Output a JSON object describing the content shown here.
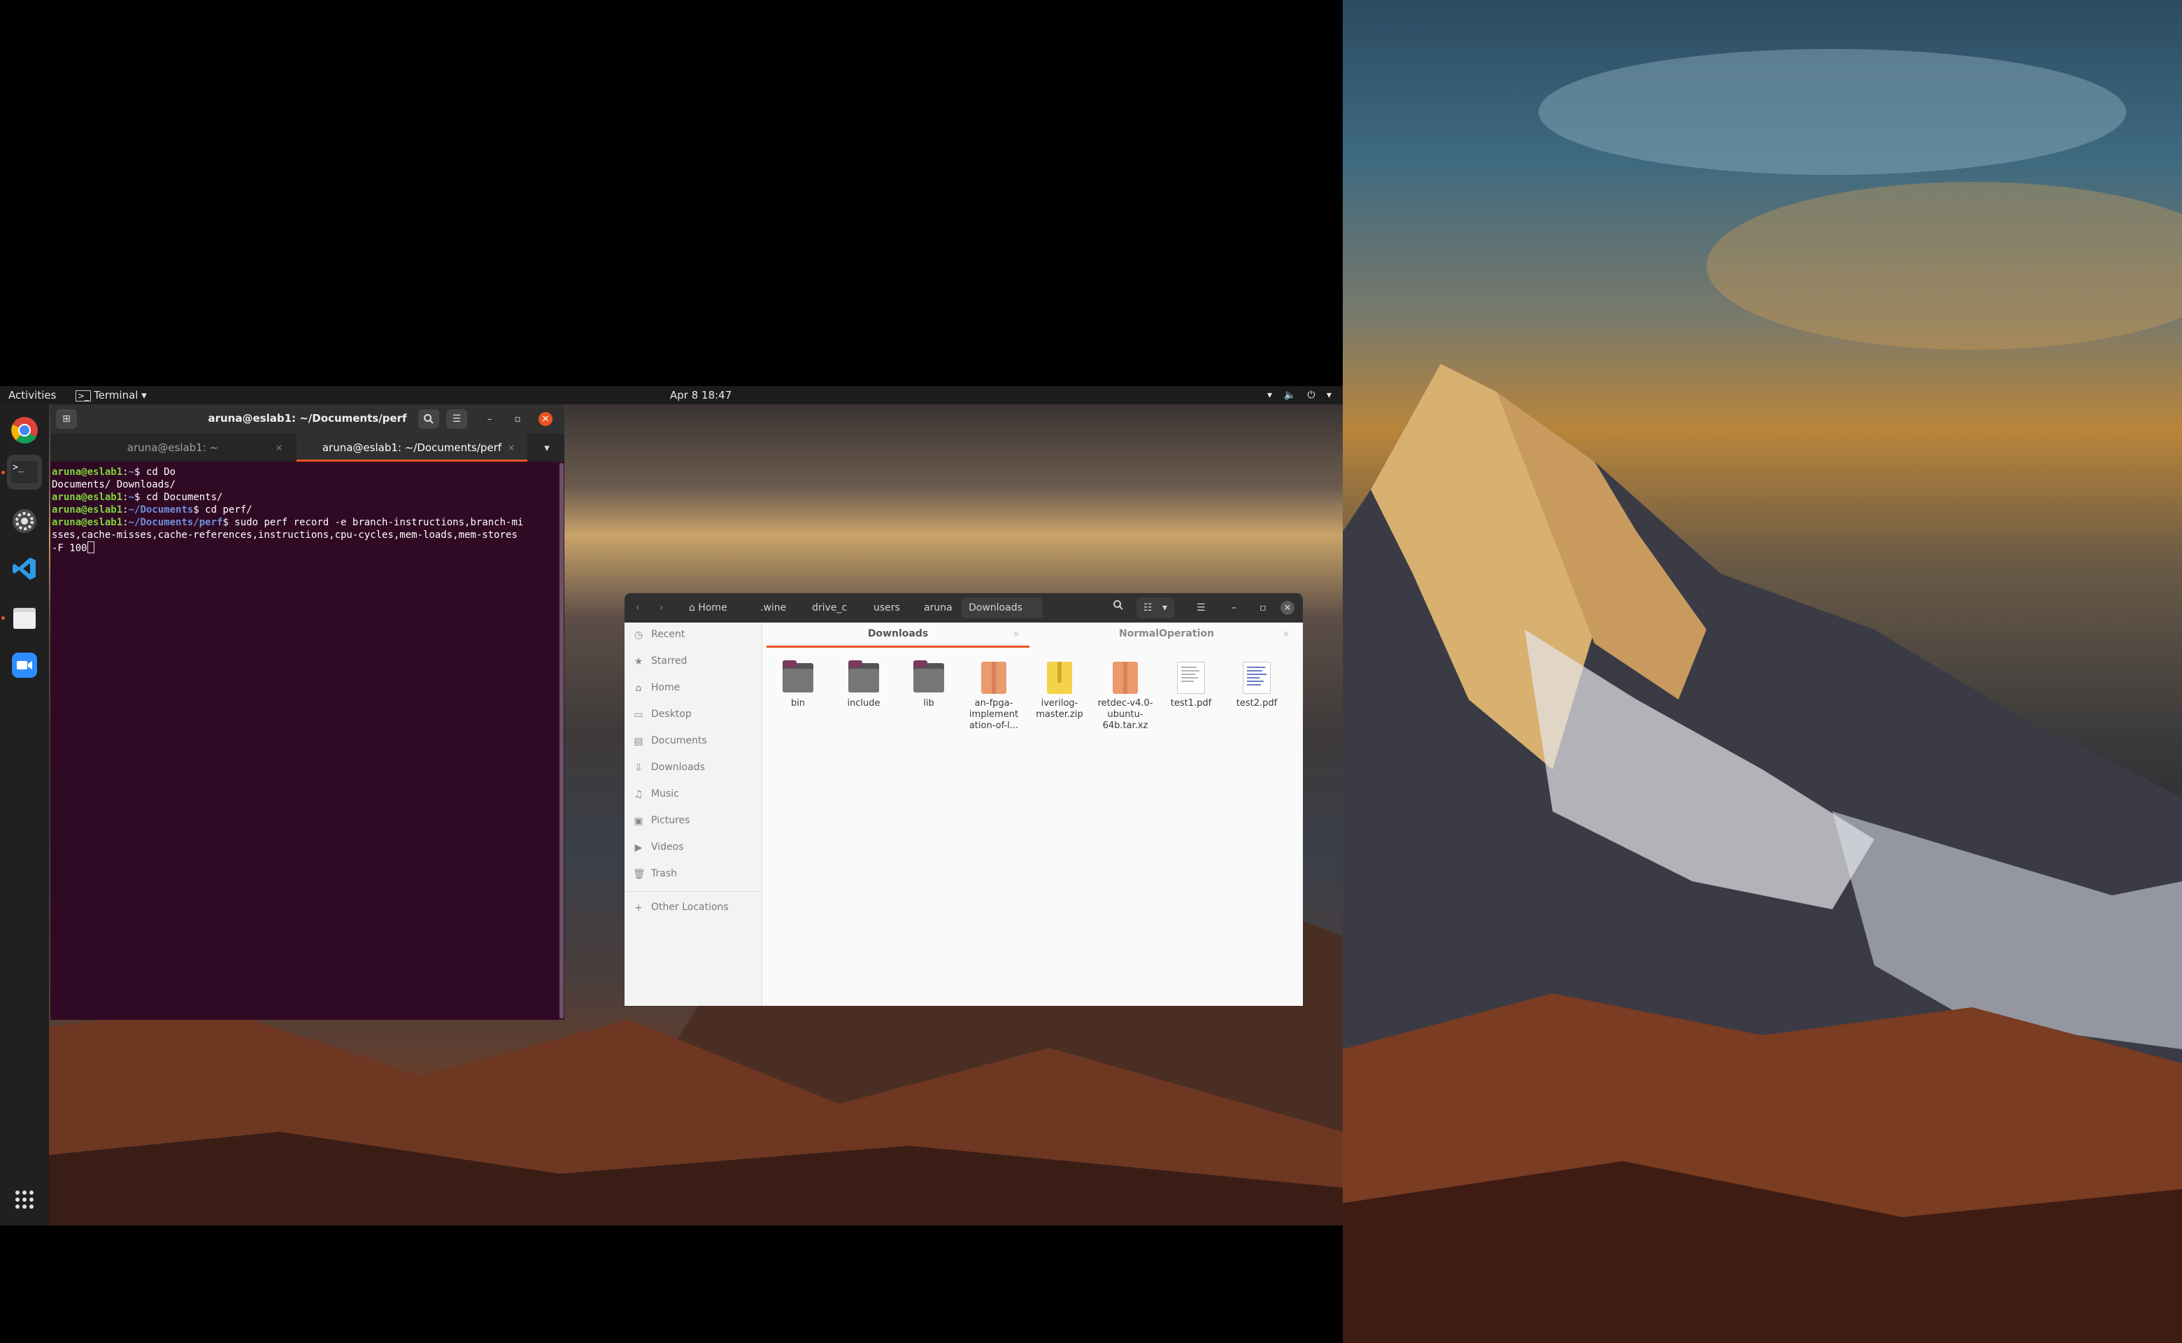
{
  "topbar": {
    "activities": "Activities",
    "app_menu": "Terminal ▾",
    "clock": "Apr 8  18:47",
    "system_icons": "▾ 🔈 ⏻ ▾"
  },
  "dock": {
    "items": [
      {
        "name": "chrome-icon"
      },
      {
        "name": "terminal-icon"
      },
      {
        "name": "settings-icon"
      },
      {
        "name": "vscode-icon"
      },
      {
        "name": "files-icon"
      },
      {
        "name": "zoom-icon"
      },
      {
        "name": "app-grid-icon"
      }
    ]
  },
  "terminal": {
    "title": "aruna@eslab1: ~/Documents/perf",
    "tabs": [
      {
        "label": "aruna@eslab1: ~",
        "close": "×"
      },
      {
        "label": "aruna@eslab1: ~/Documents/perf",
        "close": "×"
      }
    ],
    "lines": [
      {
        "user": "aruna@eslab1",
        "sep": ":",
        "path": "~",
        "cmd": "$ cd Do"
      },
      {
        "text": "Documents/ Downloads/"
      },
      {
        "user": "aruna@eslab1",
        "sep": ":",
        "path": "~",
        "cmd": "$ cd Documents/"
      },
      {
        "user": "aruna@eslab1",
        "sep": ":",
        "path": "~/Documents",
        "cmd": "$ cd perf/"
      },
      {
        "user": "aruna@eslab1",
        "sep": ":",
        "path": "~/Documents/perf",
        "cmd": "$ sudo perf record -e branch-instructions,branch-mi"
      },
      {
        "text": "sses,cache-misses,cache-references,instructions,cpu-cycles,mem-loads,mem-stores"
      },
      {
        "text": "-F 100"
      }
    ]
  },
  "files": {
    "breadcrumbs": [
      "Home",
      ".wine",
      "drive_c",
      "users",
      "aruna",
      "Downloads"
    ],
    "sidebar": [
      {
        "icon": "recent-icon",
        "glyph": "◷",
        "label": "Recent"
      },
      {
        "icon": "star-icon",
        "glyph": "★",
        "label": "Starred"
      },
      {
        "icon": "home-icon",
        "glyph": "⌂",
        "label": "Home"
      },
      {
        "icon": "desktop-icon",
        "glyph": "▭",
        "label": "Desktop"
      },
      {
        "icon": "documents-icon",
        "glyph": "▤",
        "label": "Documents"
      },
      {
        "icon": "downloads-icon",
        "glyph": "⇩",
        "label": "Downloads"
      },
      {
        "icon": "music-icon",
        "glyph": "♫",
        "label": "Music"
      },
      {
        "icon": "pictures-icon",
        "glyph": "▣",
        "label": "Pictures"
      },
      {
        "icon": "videos-icon",
        "glyph": "▶",
        "label": "Videos"
      },
      {
        "icon": "trash-icon",
        "glyph": "🗑",
        "label": "Trash"
      },
      {
        "icon": "plus-icon",
        "glyph": "+",
        "label": "Other Locations"
      }
    ],
    "tabs": [
      {
        "label": "Downloads",
        "close": "×"
      },
      {
        "label": "NormalOperation",
        "close": "×"
      }
    ],
    "items": [
      {
        "kind": "folder",
        "name": "bin"
      },
      {
        "kind": "folder",
        "name": "include"
      },
      {
        "kind": "folder",
        "name": "lib"
      },
      {
        "kind": "archive",
        "name": "an-fpga-\nimplement\nation-of-l..."
      },
      {
        "kind": "zip",
        "name": "iverilog-\nmaster.zip"
      },
      {
        "kind": "archive",
        "name": "retdec-v4.0-\nubuntu-\n64b.tar.xz"
      },
      {
        "kind": "pdf",
        "name": "test1.pdf"
      },
      {
        "kind": "pdf-blue",
        "name": "test2.pdf"
      }
    ]
  },
  "colors": {
    "accent": "#e95420",
    "terminal_bg": "#300a24",
    "prompt_user": "#7fd13b",
    "prompt_path": "#6f8fd8"
  }
}
